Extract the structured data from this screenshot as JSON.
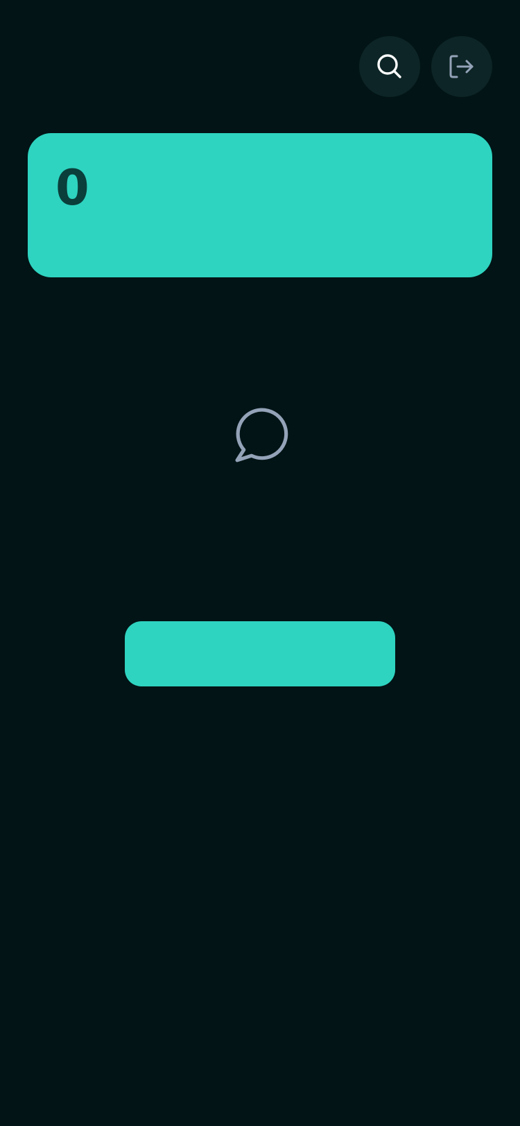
{
  "header": {
    "search_icon": "search-icon",
    "logout_icon": "logout-icon"
  },
  "summary": {
    "count": "0"
  },
  "empty_state": {
    "icon": "chat-bubble-icon"
  },
  "primary_action": {
    "label": ""
  },
  "colors": {
    "background": "#021416",
    "accent": "#2ed4c0",
    "accent_text": "#0a3f3b",
    "icon_button_bg": "#0d2526",
    "muted_icon": "#94a3b8",
    "search_icon": "#ffffff"
  }
}
